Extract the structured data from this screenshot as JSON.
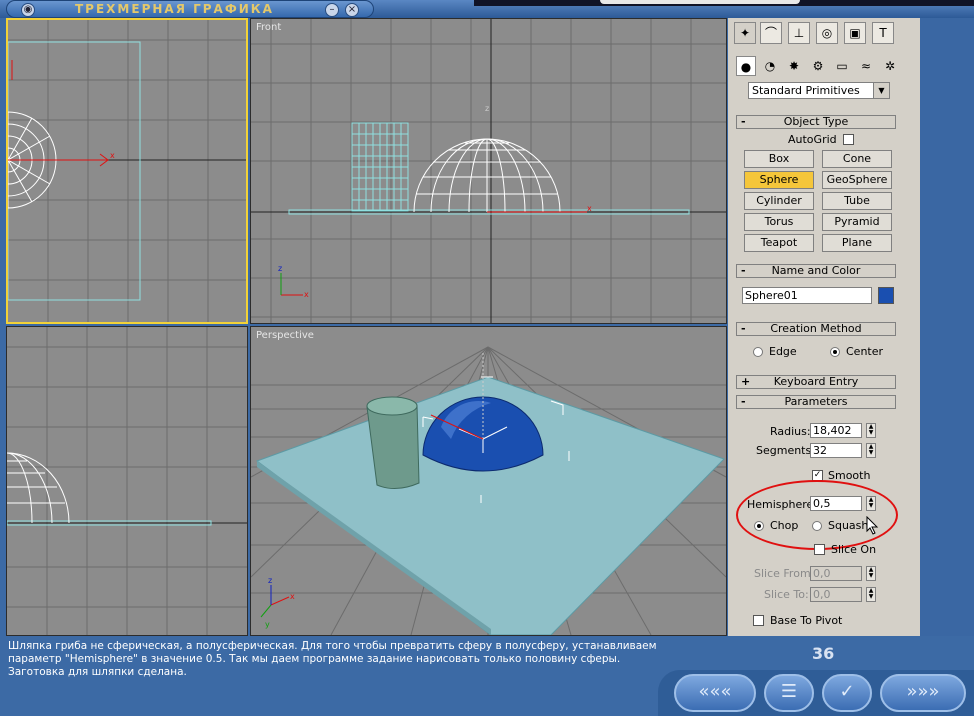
{
  "window": {
    "title": "ТРЕХМЕРНАЯ ГРАФИКА"
  },
  "viewports": {
    "front": "Front",
    "perspective": "Perspective"
  },
  "command_panel": {
    "tabs": [
      "create-icon",
      "modify-icon",
      "hierarchy-icon",
      "motion-icon",
      "display-icon",
      "utilities-icon"
    ],
    "subtabs": [
      "geometry-icon",
      "shapes-icon",
      "lights-icon",
      "cameras-icon",
      "helpers-icon",
      "spacewarps-icon",
      "systems-icon"
    ],
    "category": "Standard Primitives",
    "object_type": {
      "header": "Object Type",
      "autogrid": "AutoGrid",
      "buttons": [
        "Box",
        "Cone",
        "Sphere",
        "GeoSphere",
        "Cylinder",
        "Tube",
        "Torus",
        "Pyramid",
        "Teapot",
        "Plane"
      ],
      "active": "Sphere"
    },
    "name_color": {
      "header": "Name and Color",
      "name": "Sphere01",
      "color": "#1a4fb0"
    },
    "creation": {
      "header": "Creation Method",
      "edge": "Edge",
      "center": "Center"
    },
    "keyboard_entry": "Keyboard Entry",
    "parameters": {
      "header": "Parameters",
      "radius_label": "Radius:",
      "radius": "18,402",
      "segments_label": "Segments:",
      "segments": "32",
      "smooth": "Smooth",
      "hemisphere_label": "Hemisphere:",
      "hemisphere": "0,5",
      "chop": "Chop",
      "squash": "Squash",
      "slice_on": "Slice On",
      "slice_from_label": "Slice From:",
      "slice_from": "0,0",
      "slice_to_label": "Slice To:",
      "slice_to": "0,0",
      "base_to_pivot": "Base To Pivot"
    },
    "plus": "+",
    "minus": "-"
  },
  "bottom": {
    "message": "Шляпка гриба не сферическая, а полусферическая. Для того чтобы превратить сферу в полусферу, устанавливаем параметр \"Hemisphere\" в значение 0.5. Так мы даем программе задание нарисовать только половину сферы. Заготовка для шляпки сделана.",
    "page_number": "36"
  },
  "axes": {
    "x": "x",
    "z": "z",
    "y": "y"
  },
  "colors": {
    "accent_yellow": "#f5c63a",
    "highlight_red": "#e01010",
    "sphere_blue": "#1a4fb0"
  }
}
